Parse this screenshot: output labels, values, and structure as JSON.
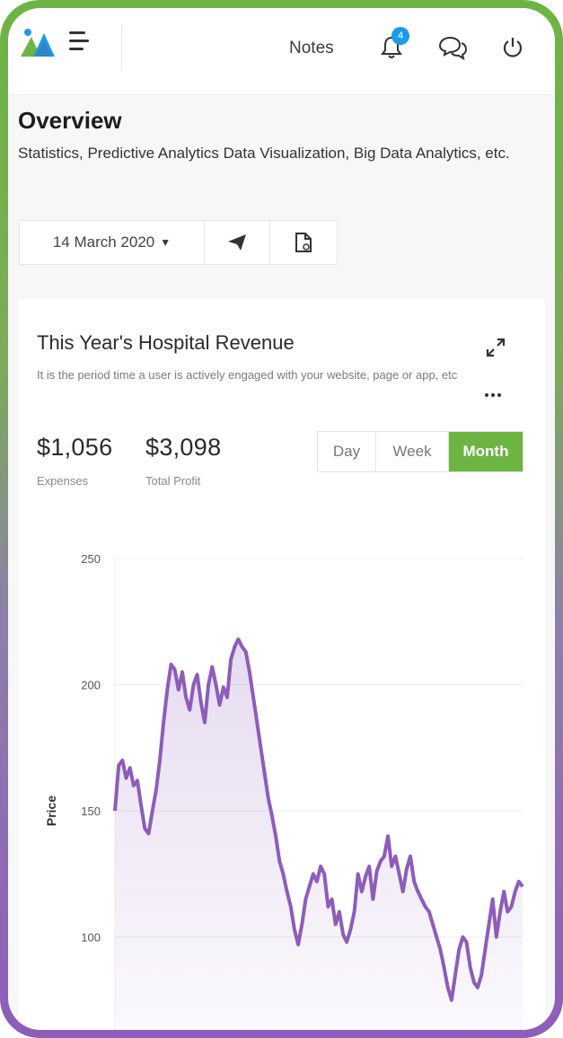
{
  "header": {
    "notes_label": "Notes",
    "notification_count": "4",
    "icons": [
      "logo-icon",
      "menu-icon",
      "bell-icon",
      "chat-icon",
      "power-icon"
    ]
  },
  "page": {
    "title": "Overview",
    "subtitle": "Statistics, Predictive Analytics Data Visualization, Big Data Analytics, etc."
  },
  "toolbar": {
    "date_label": "14 March 2020",
    "icons": [
      "send-icon",
      "document-icon"
    ]
  },
  "card": {
    "title": "This Year's Hospital Revenue",
    "description": "It is the period time a user is actively engaged with your website, page or app, etc",
    "stats": [
      {
        "value": "$1,056",
        "label": "Expenses"
      },
      {
        "value": "$3,098",
        "label": "Total Profit"
      }
    ],
    "period_options": [
      "Day",
      "Week",
      "Month"
    ],
    "selected_period": "Month"
  },
  "colors": {
    "accent": "#6cb543",
    "series": "#8d5dba",
    "badge": "#1a9be8"
  },
  "chart_data": {
    "type": "area",
    "ylabel": "Price",
    "ylim": [
      90,
      250
    ],
    "yticks": [
      250,
      200,
      150,
      100
    ],
    "grid": true,
    "series": [
      {
        "values": [
          150,
          168,
          170,
          163,
          167,
          160,
          162,
          152,
          143,
          141,
          150,
          158,
          170,
          185,
          198,
          208,
          206,
          198,
          205,
          195,
          190,
          200,
          204,
          193,
          185,
          200,
          207,
          200,
          192,
          199,
          195,
          210,
          215,
          218,
          215,
          213,
          205,
          195,
          185,
          175,
          165,
          155,
          148,
          140,
          130,
          125,
          118,
          112,
          103,
          97,
          105,
          115,
          120,
          125,
          122,
          128,
          125,
          112,
          115,
          105,
          110,
          101,
          98,
          103,
          110,
          125,
          118,
          124,
          128,
          115,
          126,
          130,
          132,
          140,
          128,
          132,
          125,
          118,
          127,
          132,
          122,
          118,
          115,
          112,
          110,
          105,
          100,
          95,
          88,
          80,
          75,
          85,
          95,
          100,
          98,
          88,
          82,
          80,
          85,
          95,
          105,
          115,
          100,
          110,
          118,
          110,
          112,
          118,
          122,
          120
        ]
      }
    ]
  }
}
